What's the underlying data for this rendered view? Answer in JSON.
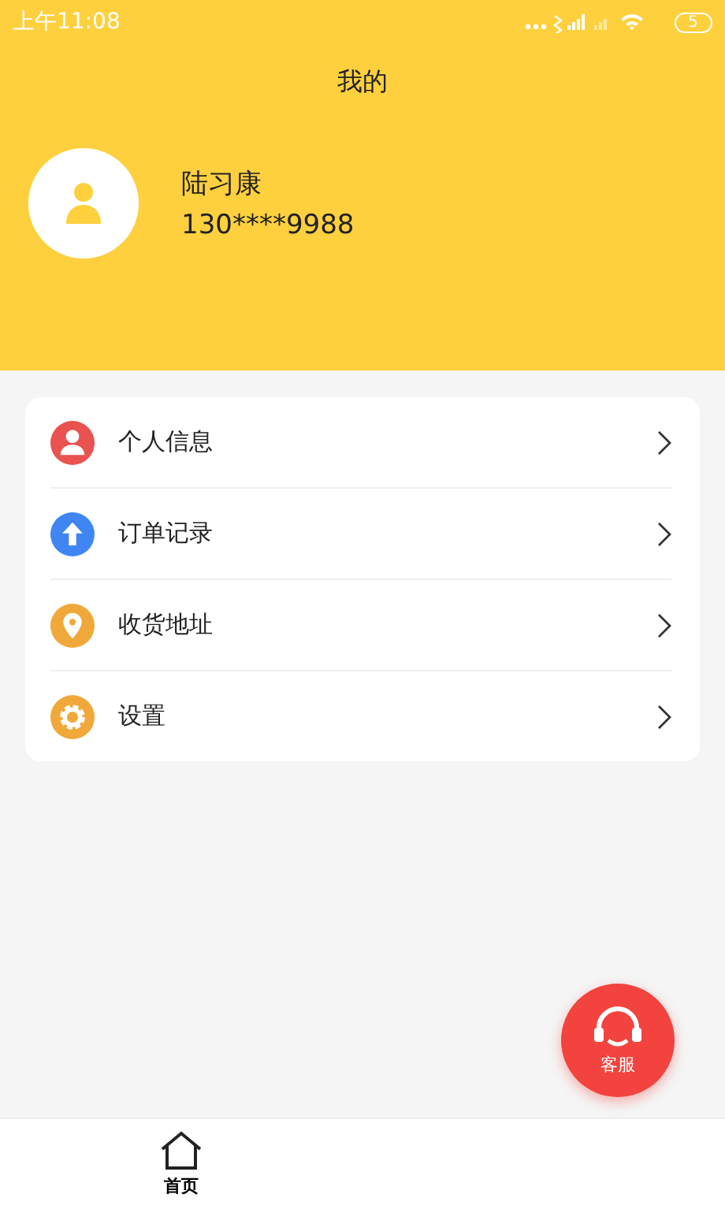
{
  "status_bar": {
    "time": "上午11:08",
    "battery": "5"
  },
  "header": {
    "title": "我的",
    "user_name": "陆习康",
    "phone": "130****9988"
  },
  "menu": [
    {
      "label": "个人信息",
      "color": "#e9524f"
    },
    {
      "label": "订单记录",
      "color": "#3f86f3"
    },
    {
      "label": "收货地址",
      "color": "#f0a83a"
    },
    {
      "label": "设置",
      "color": "#f0a83a"
    }
  ],
  "service_button": {
    "label": "客服"
  },
  "tab_bar": [
    {
      "label": "首页",
      "selected": true
    }
  ]
}
